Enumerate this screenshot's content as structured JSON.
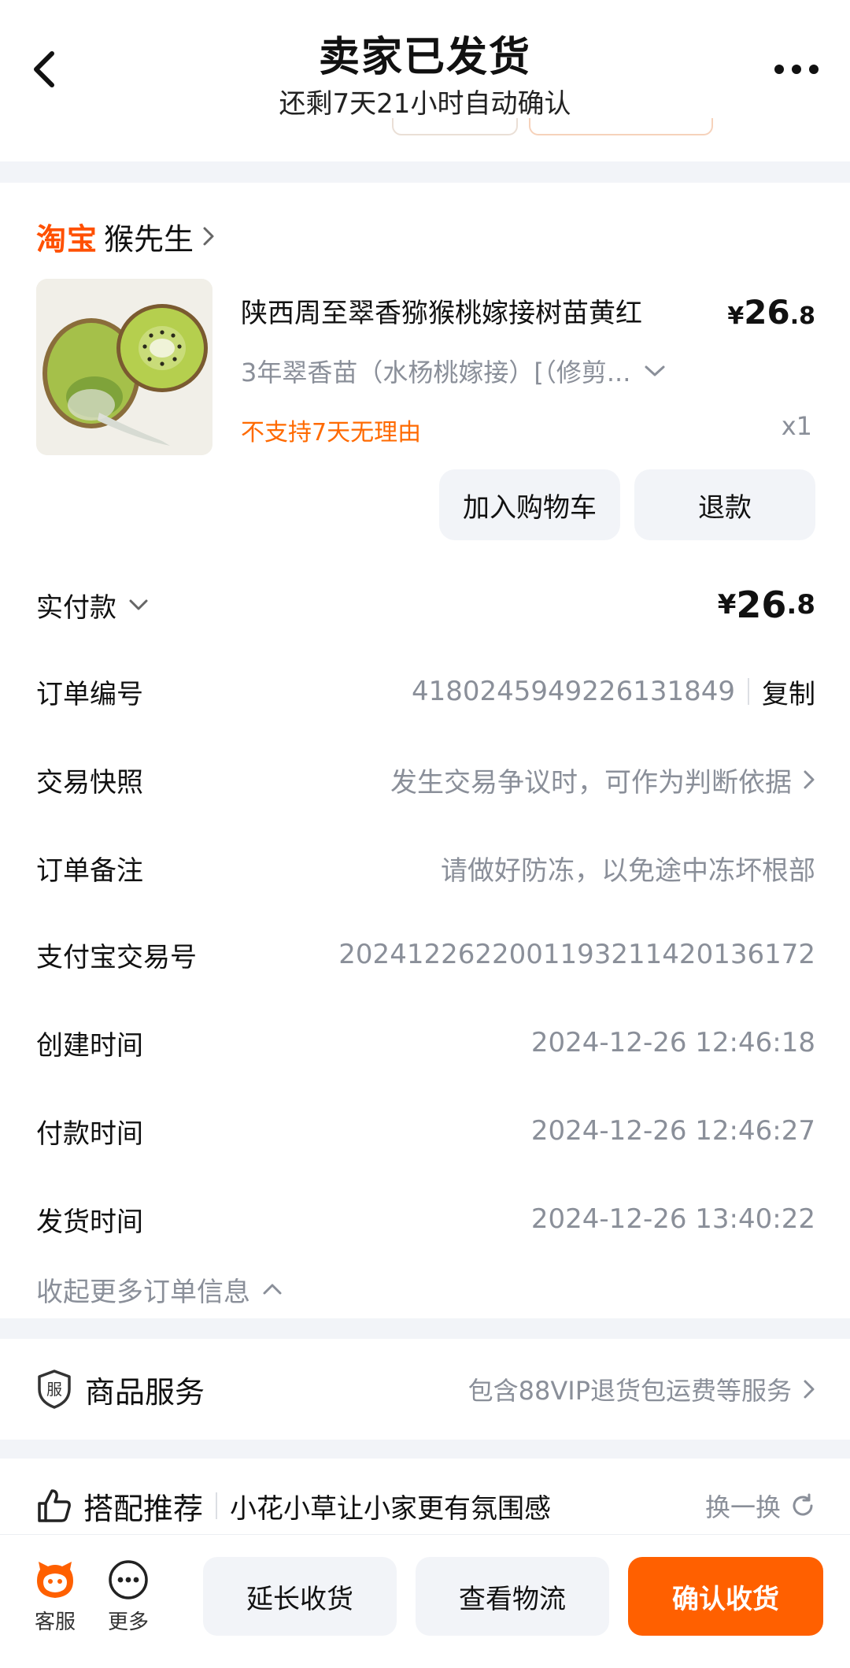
{
  "header": {
    "title": "卖家已发货",
    "subtitle": "还剩7天21小时自动确认"
  },
  "shop": {
    "platform": "淘宝",
    "name": "猴先生"
  },
  "product": {
    "title": "陕西周至翠香猕猴桃嫁接树苗黄红",
    "price_symbol": "¥",
    "price_int": "26",
    "price_dec": ".8",
    "spec": "3年翠香苗（水杨桃嫁接）[（修剪...",
    "tag": "不支持7天无理由",
    "quantity": "x1",
    "cart_button": "加入购物车",
    "refund_button": "退款"
  },
  "order_info": {
    "paid_label": "实付款",
    "paid_symbol": "¥",
    "paid_int": "26",
    "paid_dec": ".8",
    "order_no_label": "订单编号",
    "order_no": "4180245949226131849",
    "copy": "复制",
    "snapshot_label": "交易快照",
    "snapshot_value": "发生交易争议时，可作为判断依据",
    "remark_label": "订单备注",
    "remark_value": "请做好防冻，以免途中冻坏根部",
    "alipay_label": "支付宝交易号",
    "alipay_value": "2024122622001193211420136172",
    "created_label": "创建时间",
    "created_value": "2024-12-26 12:46:18",
    "paid_time_label": "付款时间",
    "paid_time_value": "2024-12-26 12:46:27",
    "shipped_label": "发货时间",
    "shipped_value": "2024-12-26 13:40:22",
    "collapse": "收起更多订单信息"
  },
  "service": {
    "badge": "服",
    "title": "商品服务",
    "value": "包含88VIP退货包运费等服务"
  },
  "recommend": {
    "title": "搭配推荐",
    "subtitle": "小花小草让小家更有氛围感",
    "swap": "换一换"
  },
  "bottom": {
    "service_label": "客服",
    "more_label": "更多",
    "extend": "延长收货",
    "logistics": "查看物流",
    "confirm": "确认收货"
  },
  "colors": {
    "accent": "#ff6000",
    "taobao": "#ff5000",
    "warning_text": "#ff6a00",
    "muted_text": "#8a8f99"
  }
}
